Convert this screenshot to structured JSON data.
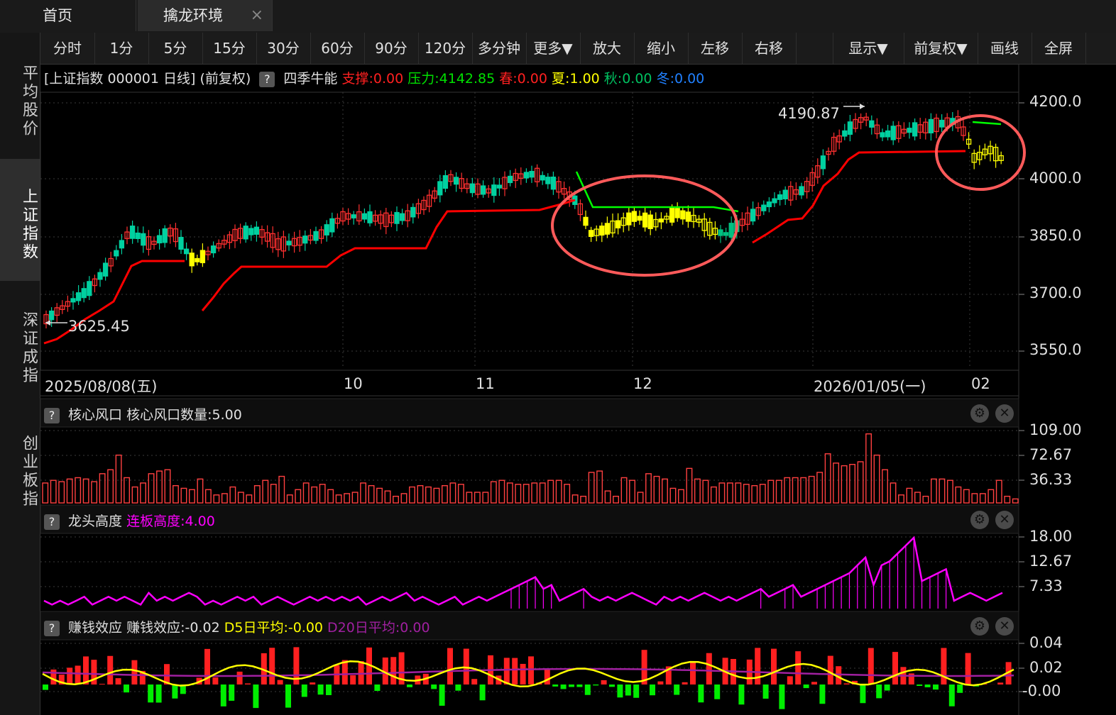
{
  "tabs": {
    "home": "首页",
    "env": "擒龙环境",
    "close": "×"
  },
  "sidebar": [
    "平均股价",
    "上证指数",
    "深证成指",
    "创业板指"
  ],
  "toolbar": [
    "分时",
    "1分",
    "5分",
    "15分",
    "30分",
    "60分",
    "90分",
    "120分",
    "多分钟",
    "更多▼",
    "放大",
    "缩小",
    "左移",
    "右移",
    "",
    "显示▼",
    "前复权▼",
    "画线",
    "全屏"
  ],
  "info": {
    "security": "[上证指数 000001 日线]",
    "adjust": "(前复权)",
    "help": "?",
    "indicator": "四季牛能",
    "support_label": "支撑:",
    "support_value": "0.00",
    "pressure_label": "压力:",
    "pressure_value": "4142.85",
    "spring_label": "春:",
    "spring_value": "0.00",
    "summer_label": "夏:",
    "summer_value": "1.00",
    "autumn_label": "秋:",
    "autumn_value": "0.00",
    "winter_label": "冬:",
    "winter_value": "0.00"
  },
  "main_chart": {
    "y_ticks": [
      "4200.0",
      "4000.0",
      "3850.0",
      "3700.0",
      "3550.0"
    ],
    "high_annotation": "4190.87",
    "low_annotation": "3625.45",
    "x_ticks": [
      "2025/08/08(五)",
      "10",
      "11",
      "12",
      "2026/01/05(一)",
      "02"
    ]
  },
  "panel1": {
    "help": "?",
    "title": "核心风口",
    "value_label": "核心风口数量:5.00",
    "y_ticks": [
      "109.00",
      "72.67",
      "36.33"
    ]
  },
  "panel2": {
    "help": "?",
    "title": "龙头高度",
    "value_label": "连板高度:4.00",
    "y_ticks": [
      "18.00",
      "12.67",
      "7.33"
    ]
  },
  "panel3": {
    "help": "?",
    "title": "赚钱效应",
    "value_label": "赚钱效应:-0.02",
    "d5_label": "D5日平均:-0.00",
    "d20_label": "D20日平均:0.00",
    "y_ticks": [
      "0.04",
      "0.02",
      "-0.00"
    ]
  },
  "icons": {
    "gear": "gear-icon",
    "close": "close-circle-icon"
  },
  "colors": {
    "up": "#ff3030",
    "down": "#00d0a0",
    "support_line": "#ff0000",
    "pressure_line": "#00ff00",
    "yellow": "#ffff00",
    "magenta": "#ff00ff",
    "circle": "#ff5050"
  },
  "chart_data": {
    "type": "candlestick",
    "price_ylim": [
      3550,
      4200
    ],
    "high": 4190.87,
    "low": 3625.45,
    "panels": [
      {
        "name": "核心风口数量",
        "last": 5.0,
        "ylim": [
          0,
          109
        ]
      },
      {
        "name": "连板高度",
        "last": 4.0,
        "ylim": [
          0,
          18
        ]
      },
      {
        "name": "赚钱效应",
        "last": -0.02,
        "d5": -0.0,
        "d20": 0.0
      }
    ]
  }
}
